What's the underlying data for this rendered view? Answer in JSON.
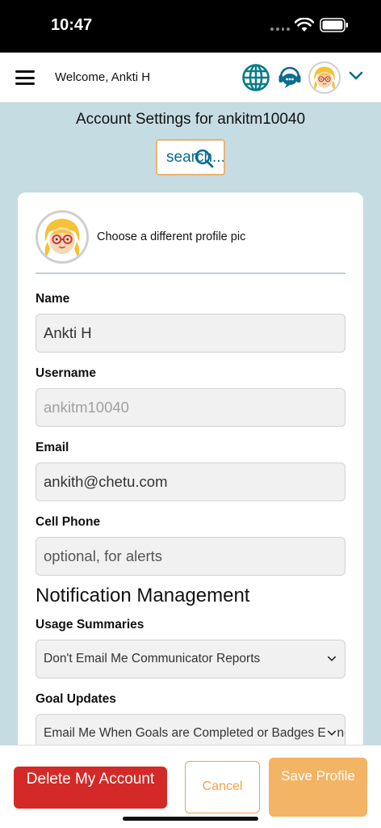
{
  "status_bar": {
    "time": "10:47"
  },
  "header": {
    "welcome": "Welcome, Ankti H"
  },
  "page": {
    "title": "Account Settings for ankitm10040",
    "search_label": "search..."
  },
  "profile": {
    "change_pic_label": "Choose a different profile pic"
  },
  "form": {
    "name_label": "Name",
    "name_value": "Ankti H",
    "username_label": "Username",
    "username_value": "ankitm10040",
    "email_label": "Email",
    "email_value": "ankith@chetu.com",
    "phone_label": "Cell Phone",
    "phone_placeholder": "optional, for alerts"
  },
  "notifications": {
    "heading": "Notification Management",
    "usage_label": "Usage Summaries",
    "usage_selected": "Don't Email Me Communicator Reports",
    "goal_label": "Goal Updates",
    "goal_selected": "Email Me When Goals are Completed or Badges Earned"
  },
  "footer": {
    "delete_label": "Delete My Account",
    "cancel_label": "Cancel",
    "save_label": "Save Profile"
  },
  "icons": {
    "menu": "hamburger-menu-icon",
    "globe": "globe-icon",
    "chat": "support-chat-icon",
    "avatar": "cartoon-avatar",
    "chevron": "chevron-down-icon",
    "search": "magnifier-icon"
  },
  "colors": {
    "background": "#c5dce2",
    "teal": "#0a7c86",
    "delete": "#d42a27",
    "accent_orange": "#f0a24a",
    "save": "#f3b465"
  }
}
